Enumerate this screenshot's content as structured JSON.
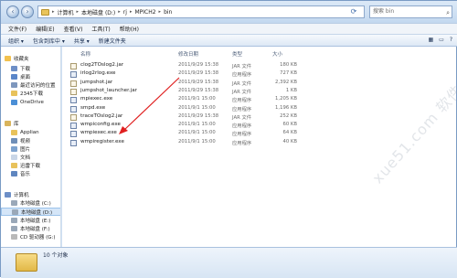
{
  "address": {
    "crumbs": [
      "计算机",
      "本地磁盘 (D:)",
      "rj",
      "MPICH2",
      "bin"
    ],
    "search_placeholder": "搜索 bin"
  },
  "menu": [
    "文件(F)",
    "编辑(E)",
    "查看(V)",
    "工具(T)",
    "帮助(H)"
  ],
  "toolbar": [
    "组织 ▾",
    "包含到库中 ▾",
    "共享 ▾",
    "新建文件夹"
  ],
  "nav": [
    {
      "label": "收藏夹",
      "icon": "star-icon",
      "color": "#f2c14e",
      "level": 0
    },
    {
      "label": "下载",
      "icon": "download-folder-icon",
      "color": "#6d8fc7",
      "level": 1
    },
    {
      "label": "桌面",
      "icon": "desktop-icon",
      "color": "#5a86c9",
      "level": 1
    },
    {
      "label": "最近访问的位置",
      "icon": "recent-places-icon",
      "color": "#7e97bd",
      "level": 1
    },
    {
      "label": "2345下载",
      "icon": "folder-icon",
      "color": "#e8c25b",
      "level": 1
    },
    {
      "label": "OneDrive",
      "icon": "cloud-icon",
      "color": "#4b8fd6",
      "level": 1
    },
    {
      "label": "库",
      "icon": "library-icon",
      "color": "#d9b45c",
      "level": 0
    },
    {
      "label": "Applian",
      "icon": "folder-icon",
      "color": "#e8c25b",
      "level": 1
    },
    {
      "label": "视频",
      "icon": "video-icon",
      "color": "#6f8fb8",
      "level": 1
    },
    {
      "label": "图片",
      "icon": "pictures-icon",
      "color": "#7ea3cf",
      "level": 1
    },
    {
      "label": "文档",
      "icon": "documents-icon",
      "color": "#c9d6e7",
      "level": 1
    },
    {
      "label": "迅雷下载",
      "icon": "folder-icon",
      "color": "#e8c25b",
      "level": 1
    },
    {
      "label": "音乐",
      "icon": "music-icon",
      "color": "#5f86bf",
      "level": 1
    },
    {
      "label": "计算机",
      "icon": "computer-icon",
      "color": "#6d8fc7",
      "level": 0
    },
    {
      "label": "本地磁盘 (C:)",
      "icon": "drive-icon",
      "color": "#9aa8b8",
      "level": 1
    },
    {
      "label": "本地磁盘 (D:)",
      "icon": "drive-icon",
      "color": "#9aa8b8",
      "level": 1,
      "selected": true
    },
    {
      "label": "本地磁盘 (E:)",
      "icon": "drive-icon",
      "color": "#9aa8b8",
      "level": 1
    },
    {
      "label": "本地磁盘 (F:)",
      "icon": "drive-icon",
      "color": "#9aa8b8",
      "level": 1
    },
    {
      "label": "CD 驱动器 (G:)",
      "icon": "cd-drive-icon",
      "color": "#b9b9b9",
      "level": 1
    }
  ],
  "columns": {
    "name": "名称",
    "date": "修改日期",
    "type": "类型",
    "size": "大小"
  },
  "files": [
    {
      "name": "clog2TOslog2.jar",
      "date": "2011/9/29 15:38",
      "type": "JAR 文件",
      "size": "180 KB",
      "kind": "jar"
    },
    {
      "name": "irlog2rlog.exe",
      "date": "2011/9/29 15:38",
      "type": "应用程序",
      "size": "727 KB",
      "kind": "exe"
    },
    {
      "name": "jumpshot.jar",
      "date": "2011/9/29 15:38",
      "type": "JAR 文件",
      "size": "2,392 KB",
      "kind": "jar"
    },
    {
      "name": "jumpshot_launcher.jar",
      "date": "2011/9/29 15:38",
      "type": "JAR 文件",
      "size": "1 KB",
      "kind": "jar"
    },
    {
      "name": "mpiexec.exe",
      "date": "2011/9/1 15:00",
      "type": "应用程序",
      "size": "1,205 KB",
      "kind": "exe"
    },
    {
      "name": "smpd.exe",
      "date": "2011/9/1 15:00",
      "type": "应用程序",
      "size": "1,196 KB",
      "kind": "exe"
    },
    {
      "name": "traceTOslog2.jar",
      "date": "2011/9/29 15:38",
      "type": "JAR 文件",
      "size": "252 KB",
      "kind": "jar"
    },
    {
      "name": "wmpiconfig.exe",
      "date": "2011/9/1 15:00",
      "type": "应用程序",
      "size": "60 KB",
      "kind": "exe"
    },
    {
      "name": "wmpiexec.exe",
      "date": "2011/9/1 15:00",
      "type": "应用程序",
      "size": "64 KB",
      "kind": "exe"
    },
    {
      "name": "wmpiregister.exe",
      "date": "2011/9/1 15:00",
      "type": "应用程序",
      "size": "40 KB",
      "kind": "exe"
    }
  ],
  "status": {
    "count": "10 个对象"
  },
  "watermark": "xue51.com 软件学堂"
}
